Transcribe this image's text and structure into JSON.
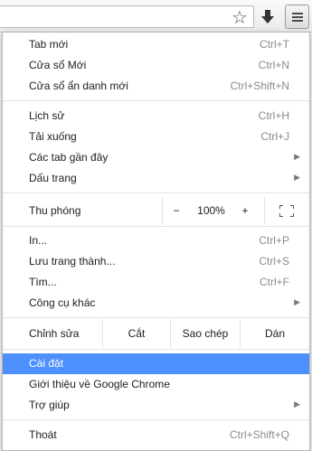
{
  "toolbar": {
    "star_icon": "star-outline-icon",
    "download_icon": "download-arrow-icon",
    "menu_icon": "hamburger-menu-icon"
  },
  "menu": {
    "group1": [
      {
        "label": "Tab mới",
        "shortcut": "Ctrl+T"
      },
      {
        "label": "Cửa sổ Mới",
        "shortcut": "Ctrl+N"
      },
      {
        "label": "Cửa sổ ẩn danh mới",
        "shortcut": "Ctrl+Shift+N"
      }
    ],
    "group2": [
      {
        "label": "Lịch sử",
        "shortcut": "Ctrl+H"
      },
      {
        "label": "Tải xuống",
        "shortcut": "Ctrl+J"
      },
      {
        "label": "Các tab gần đây",
        "shortcut": ""
      },
      {
        "label": "Dấu trang",
        "shortcut": ""
      }
    ],
    "zoom": {
      "label": "Thu phóng",
      "minus": "−",
      "value": "100%",
      "plus": "+"
    },
    "group3": [
      {
        "label": "In...",
        "shortcut": "Ctrl+P"
      },
      {
        "label": "Lưu trang thành...",
        "shortcut": "Ctrl+S"
      },
      {
        "label": "Tìm...",
        "shortcut": "Ctrl+F"
      },
      {
        "label": "Công cụ khác",
        "shortcut": ""
      }
    ],
    "edit": {
      "label": "Chỉnh sửa",
      "cut": "Cắt",
      "copy": "Sao chép",
      "paste": "Dán"
    },
    "group4": [
      {
        "label": "Cài đặt",
        "shortcut": ""
      },
      {
        "label": "Giới thiệu về Google Chrome",
        "shortcut": ""
      },
      {
        "label": "Trợ giúp",
        "shortcut": ""
      }
    ],
    "exit": {
      "label": "Thoát",
      "shortcut": "Ctrl+Shift+Q"
    }
  },
  "colors": {
    "highlight": "#4d90fe",
    "shortcut_text": "#8a8a8a"
  }
}
